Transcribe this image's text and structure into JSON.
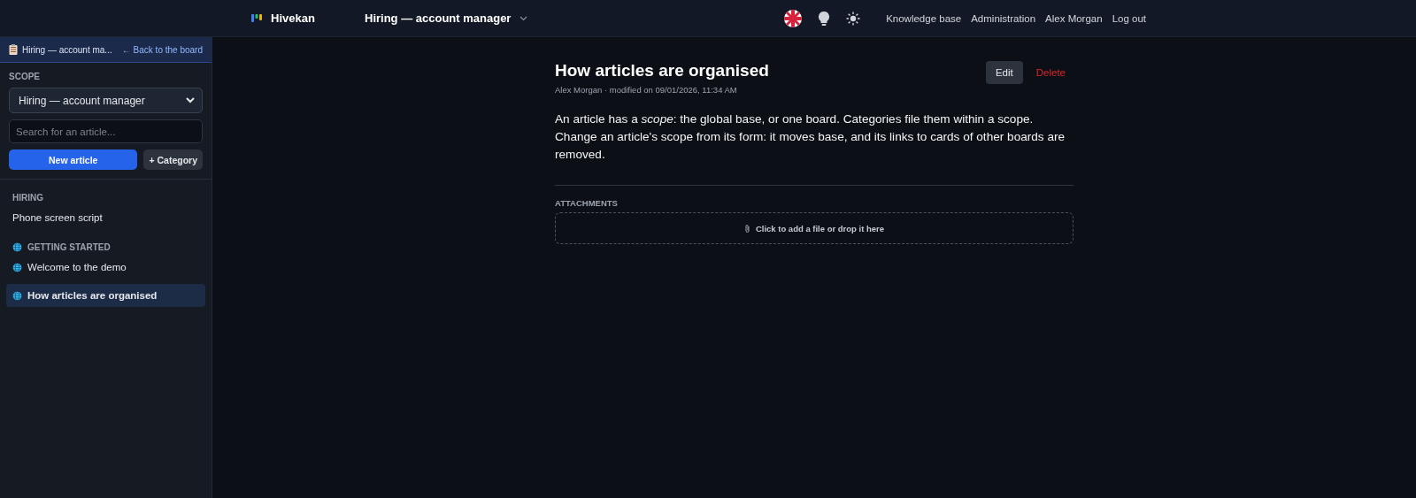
{
  "header": {
    "app_name": "Hivekan",
    "board": "Hiring — account manager",
    "nav": [
      "Knowledge base",
      "Administration",
      "Alex Morgan",
      "Log out"
    ]
  },
  "sidebar": {
    "board_link": "Hiring — account ma...",
    "back_link": "← Back to the board",
    "scope_label": "SCOPE",
    "scope_value": "Hiring — account manager",
    "search": {
      "placeholder": "Search for an article..."
    },
    "new_button": "New article",
    "category_button": "+ Category",
    "categories": [
      {
        "name": "HIRING",
        "global": false,
        "articles": [
          {
            "title": "Phone screen script",
            "global": false,
            "selected": false
          }
        ]
      },
      {
        "name": "GETTING STARTED",
        "global": true,
        "articles": [
          {
            "title": "Welcome to the demo",
            "global": true,
            "selected": false
          },
          {
            "title": "How articles are organised",
            "global": true,
            "selected": true
          }
        ]
      }
    ]
  },
  "article": {
    "title": "How articles are organised",
    "meta": "Alex Morgan · modified on 09/01/2026, 11:34 AM",
    "actions": [
      "Edit",
      "Delete"
    ],
    "body": [
      "An article has a *scope*: the global base, or one board. Categories file them within a scope.",
      "Change an article's scope from its form: it moves base, and its links to cards of other boards are removed."
    ],
    "attachments_label": "ATTACHMENTS",
    "dropzone": "Click to add a file or drop it here"
  }
}
